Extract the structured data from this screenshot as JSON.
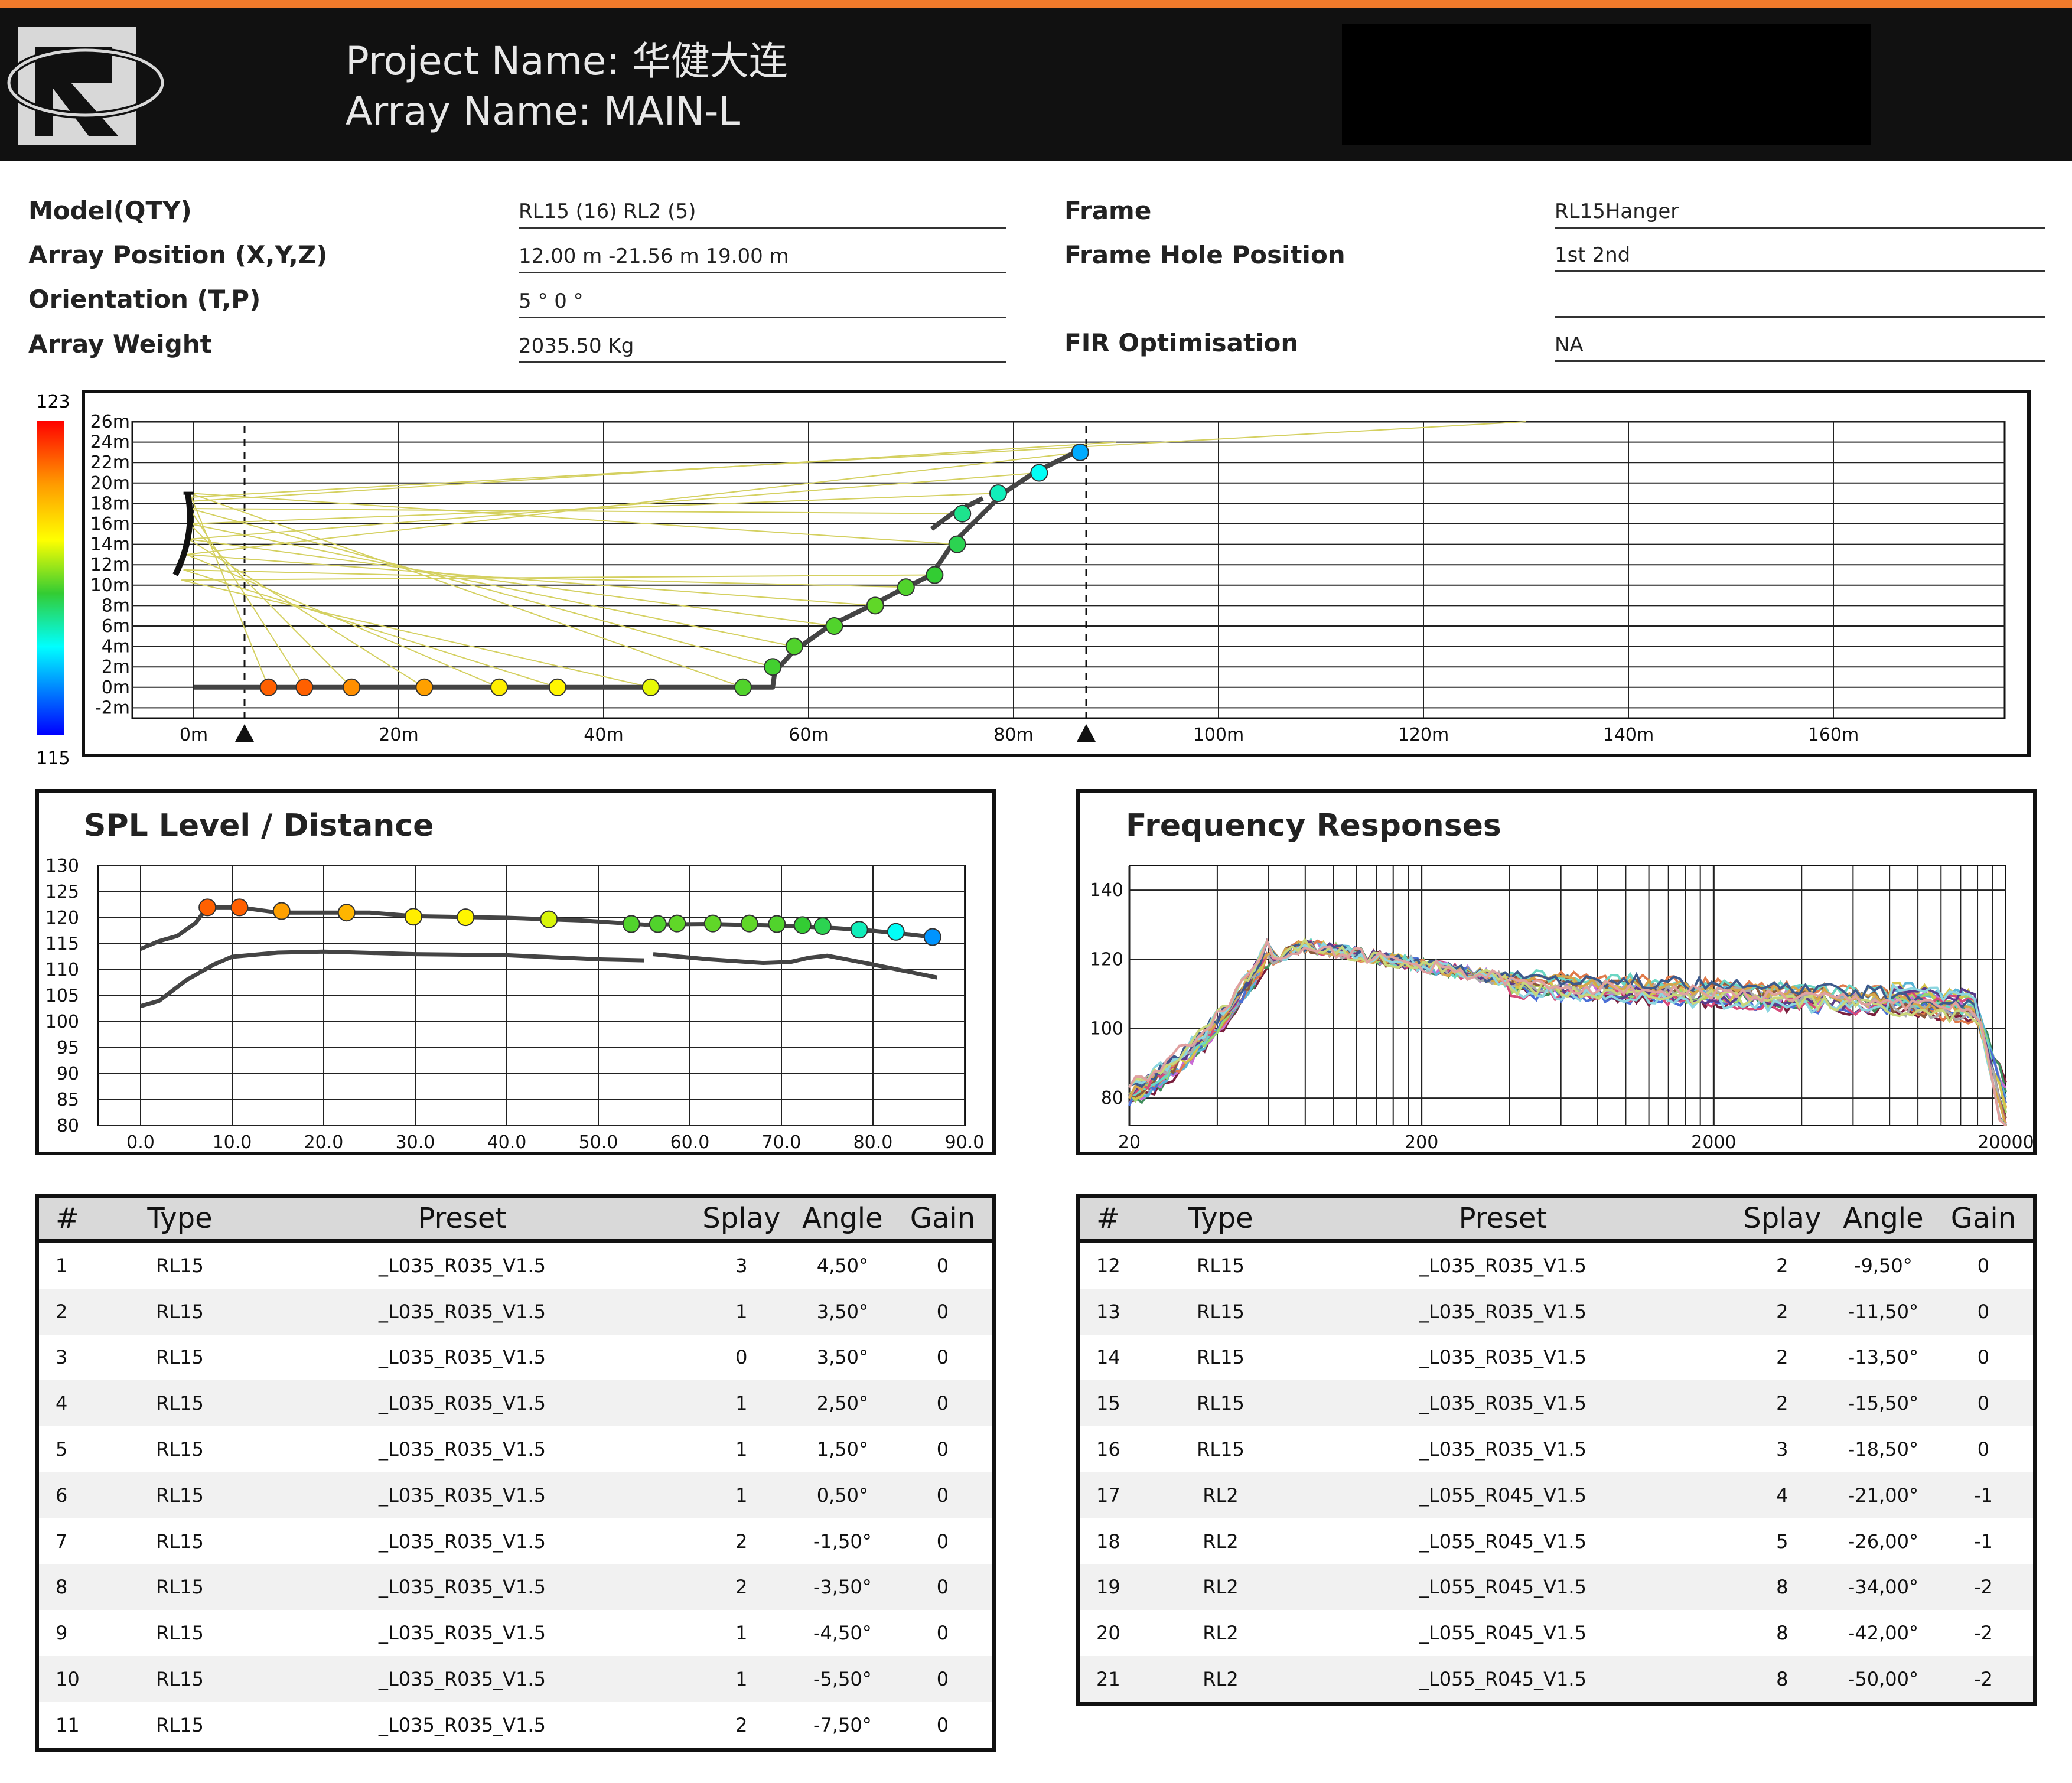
{
  "header": {
    "project_label": "Project Name:",
    "project_name": "华健大连",
    "array_label": "Array Name:",
    "array_name": "MAIN-L",
    "accent_color": "#f07a2b"
  },
  "info": {
    "left": [
      {
        "label": "Model(QTY)",
        "value": "RL15 (16) RL2 (5)"
      },
      {
        "label": "Array Position (X,Y,Z)",
        "value": "12.00 m -21.56 m 19.00 m"
      },
      {
        "label": "Orientation (T,P)",
        "value": "5 °   0 °"
      },
      {
        "label": "Array Weight",
        "value": "2035.50 Kg"
      }
    ],
    "right": [
      {
        "label": "Frame",
        "value": "RL15Hanger"
      },
      {
        "label": "Frame Hole Position",
        "value": "1st 2nd"
      },
      {
        "label": "",
        "value": ""
      },
      {
        "label": "FIR Optimisation",
        "value": "NA"
      }
    ]
  },
  "colorbar": {
    "max_label": "123",
    "min_label": "115"
  },
  "coverage_plot": {
    "y_ticks": [
      "26m",
      "24m",
      "22m",
      "20m",
      "18m",
      "16m",
      "14m",
      "12m",
      "10m",
      "8m",
      "6m",
      "4m",
      "2m",
      "0m",
      "-2m"
    ],
    "x_ticks": [
      "0m",
      "20m",
      "40m",
      "60m",
      "80m",
      "100m",
      "120m",
      "140m",
      "160m"
    ]
  },
  "spl_chart": {
    "title": "SPL Level / Distance",
    "y_ticks": [
      "130",
      "125",
      "120",
      "115",
      "110",
      "105",
      "100",
      "95",
      "90",
      "85",
      "80"
    ],
    "x_ticks": [
      "0.0",
      "10.0",
      "20.0",
      "30.0",
      "40.0",
      "50.0",
      "60.0",
      "70.0",
      "80.0",
      "90.0"
    ]
  },
  "freq_chart": {
    "title": "Frequency Responses",
    "y_ticks": [
      "140",
      "120",
      "100",
      "80"
    ],
    "x_ticks": [
      "20",
      "200",
      "2000",
      "20000"
    ]
  },
  "table_headers": [
    "#",
    "Type",
    "Preset",
    "Splay",
    "Angle",
    "Gain"
  ],
  "table_left": [
    [
      "1",
      "RL15",
      "_L035_R035_V1.5",
      "3",
      "4,50°",
      "0"
    ],
    [
      "2",
      "RL15",
      "_L035_R035_V1.5",
      "1",
      "3,50°",
      "0"
    ],
    [
      "3",
      "RL15",
      "_L035_R035_V1.5",
      "0",
      "3,50°",
      "0"
    ],
    [
      "4",
      "RL15",
      "_L035_R035_V1.5",
      "1",
      "2,50°",
      "0"
    ],
    [
      "5",
      "RL15",
      "_L035_R035_V1.5",
      "1",
      "1,50°",
      "0"
    ],
    [
      "6",
      "RL15",
      "_L035_R035_V1.5",
      "1",
      "0,50°",
      "0"
    ],
    [
      "7",
      "RL15",
      "_L035_R035_V1.5",
      "2",
      "-1,50°",
      "0"
    ],
    [
      "8",
      "RL15",
      "_L035_R035_V1.5",
      "2",
      "-3,50°",
      "0"
    ],
    [
      "9",
      "RL15",
      "_L035_R035_V1.5",
      "1",
      "-4,50°",
      "0"
    ],
    [
      "10",
      "RL15",
      "_L035_R035_V1.5",
      "1",
      "-5,50°",
      "0"
    ],
    [
      "11",
      "RL15",
      "_L035_R035_V1.5",
      "2",
      "-7,50°",
      "0"
    ]
  ],
  "table_right": [
    [
      "12",
      "RL15",
      "_L035_R035_V1.5",
      "2",
      "-9,50°",
      "0"
    ],
    [
      "13",
      "RL15",
      "_L035_R035_V1.5",
      "2",
      "-11,50°",
      "0"
    ],
    [
      "14",
      "RL15",
      "_L035_R035_V1.5",
      "2",
      "-13,50°",
      "0"
    ],
    [
      "15",
      "RL15",
      "_L035_R035_V1.5",
      "2",
      "-15,50°",
      "0"
    ],
    [
      "16",
      "RL15",
      "_L035_R035_V1.5",
      "3",
      "-18,50°",
      "0"
    ],
    [
      "17",
      "RL2",
      "_L055_R045_V1.5",
      "4",
      "-21,00°",
      "-1"
    ],
    [
      "18",
      "RL2",
      "_L055_R045_V1.5",
      "5",
      "-26,00°",
      "-1"
    ],
    [
      "19",
      "RL2",
      "_L055_R045_V1.5",
      "8",
      "-34,00°",
      "-2"
    ],
    [
      "20",
      "RL2",
      "_L055_R045_V1.5",
      "8",
      "-42,00°",
      "-2"
    ],
    [
      "21",
      "RL2",
      "_L055_R045_V1.5",
      "8",
      "-50,00°",
      "-2"
    ]
  ]
}
